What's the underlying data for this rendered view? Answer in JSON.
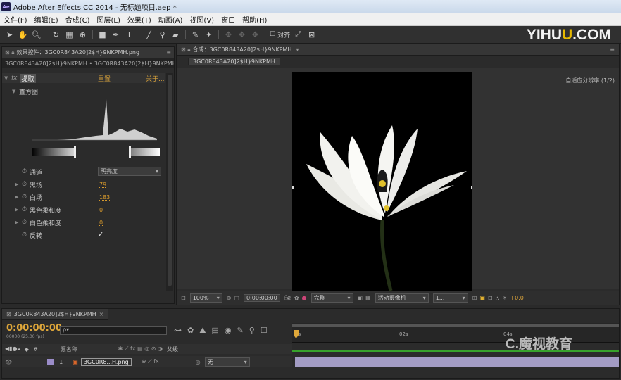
{
  "window": {
    "title": "Adobe After Effects CC 2014 - 无标题项目.aep *",
    "app_badge": "Ae"
  },
  "menu": [
    "文件(F)",
    "编辑(E)",
    "合成(C)",
    "图层(L)",
    "效果(T)",
    "动画(A)",
    "视图(V)",
    "窗口",
    "帮助(H)"
  ],
  "toolbar": {
    "align_label": "对齐"
  },
  "watermarks": {
    "site_prefix": "YIHU",
    "site_u": "U",
    "site_suffix": ".COM",
    "brand": "C.魔视教育"
  },
  "effects_panel": {
    "tab": "效果控件：3GC0R843A20]2$H}9NKPMH.png",
    "layer_path": "3GC0R843A20]2$H}9NKPMH • 3GC0R843A20]2$H}9NKPMH.",
    "effect_name": "提取",
    "reset_label": "重置",
    "about_label": "关于...",
    "histogram_label": "直方图",
    "properties": [
      {
        "name": "通道",
        "value": "明亮度",
        "type": "dropdown",
        "expand": false
      },
      {
        "name": "黑场",
        "value": "79",
        "type": "number",
        "expand": true
      },
      {
        "name": "白场",
        "value": "183",
        "type": "number",
        "expand": true
      },
      {
        "name": "黑色柔和度",
        "value": "0",
        "type": "number",
        "expand": true
      },
      {
        "name": "白色柔和度",
        "value": "0",
        "type": "number",
        "expand": true
      },
      {
        "name": "反转",
        "value": "✓",
        "type": "checkbox",
        "expand": false
      }
    ]
  },
  "comp_panel": {
    "tab": "合成：3GC0R843A20]2$H}9NKPMH",
    "subtab": "3GC0R843A20]2$H}9NKPMH",
    "resolution_label": "自适应分辨率 (1/2)",
    "footer": {
      "zoom": "100%",
      "timecode": "0:00:00:00",
      "quality": "完整",
      "camera": "活动摄像机",
      "views": "1...",
      "exposure": "+0.0"
    }
  },
  "timeline": {
    "tab": "3GC0R843A20]2$H}9NKPMH",
    "timecode": "0:00:00:00",
    "fps": "00000 (25.00 fps)",
    "search_placeholder": "ρ▾",
    "col_source": "源名称",
    "col_parent": "父级",
    "ruler": [
      "0s",
      "02s",
      "04s"
    ],
    "layer": {
      "index": "1",
      "name": "3GC0R8...H.png",
      "parent": "无"
    }
  }
}
